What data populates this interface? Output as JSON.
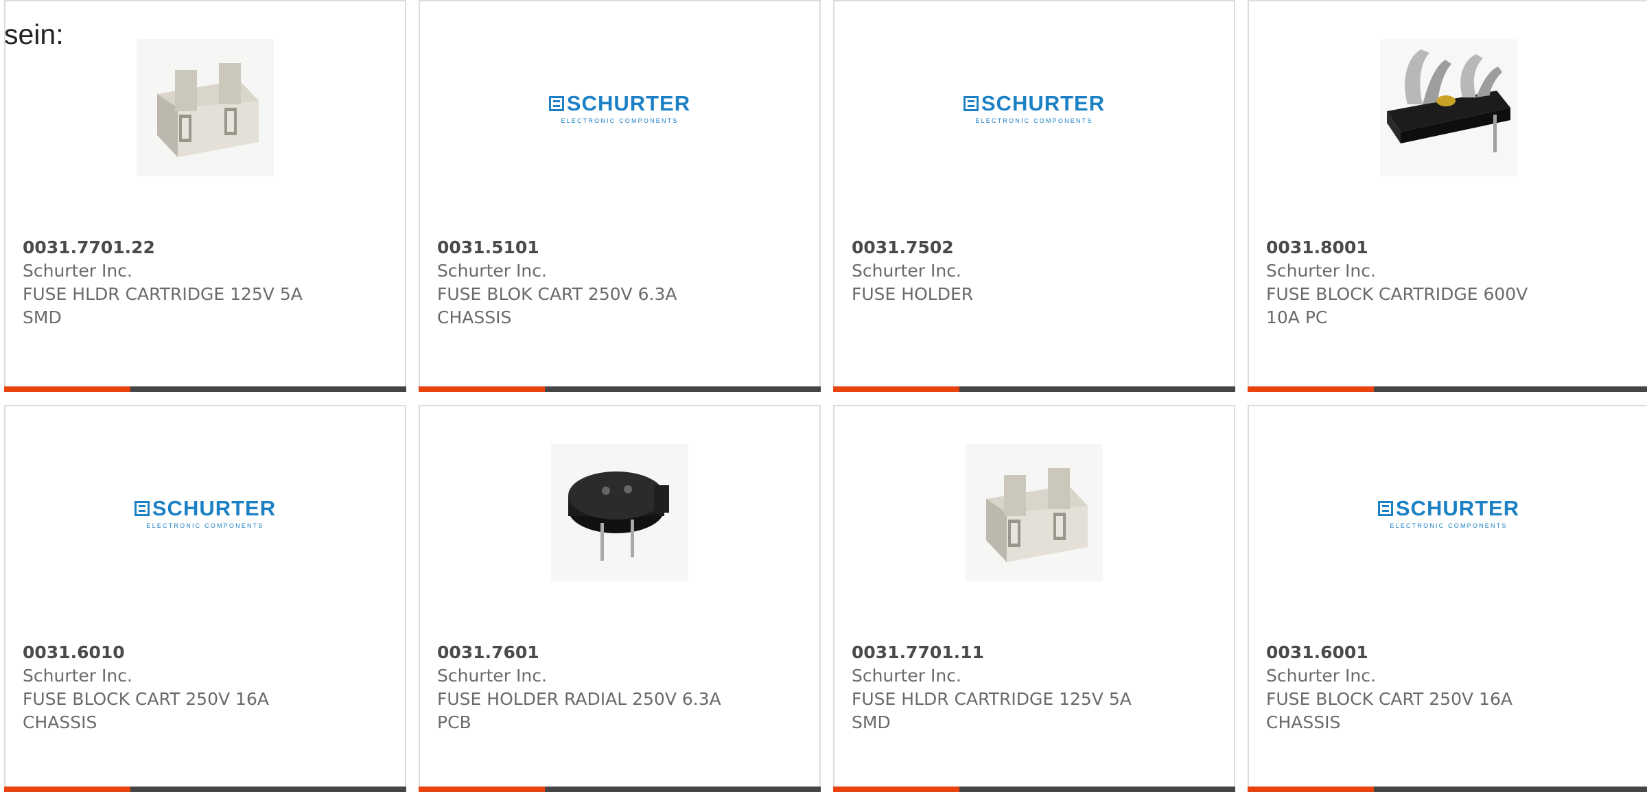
{
  "intro_text": "sein:",
  "brand_logo": {
    "word": "SCHURTER",
    "tagline": "ELECTRONIC COMPONENTS"
  },
  "colors": {
    "accent": "#e8430f",
    "bar": "#454545",
    "logo_blue": "#1b80c4"
  },
  "products": [
    {
      "part_number": "0031.7701.22",
      "manufacturer": "Schurter Inc.",
      "description": "FUSE HLDR CARTRIDGE 125V 5A\nSMD",
      "image": "fuse-holder-photo-icon"
    },
    {
      "part_number": "0031.5101",
      "manufacturer": "Schurter Inc.",
      "description": "FUSE BLOK CART 250V 6.3A\nCHASSIS",
      "image": "schurter-logo"
    },
    {
      "part_number": "0031.7502",
      "manufacturer": "Schurter Inc.",
      "description": "FUSE HOLDER",
      "image": "schurter-logo"
    },
    {
      "part_number": "0031.8001",
      "manufacturer": "Schurter Inc.",
      "description": "FUSE BLOCK CARTRIDGE 600V\n10A PC",
      "image": "fuse-block-clip-photo-icon"
    },
    {
      "part_number": "0031.6010",
      "manufacturer": "Schurter Inc.",
      "description": "FUSE BLOCK CART 250V 16A\nCHASSIS",
      "image": "schurter-logo"
    },
    {
      "part_number": "0031.7601",
      "manufacturer": "Schurter Inc.",
      "description": "FUSE HOLDER RADIAL 250V 6.3A\nPCB",
      "image": "radial-fuse-holder-photo-icon"
    },
    {
      "part_number": "0031.7701.11",
      "manufacturer": "Schurter Inc.",
      "description": "FUSE HLDR CARTRIDGE 125V 5A\nSMD",
      "image": "fuse-holder-photo-icon"
    },
    {
      "part_number": "0031.6001",
      "manufacturer": "Schurter Inc.",
      "description": "FUSE BLOCK CART 250V 16A\nCHASSIS",
      "image": "schurter-logo"
    }
  ]
}
